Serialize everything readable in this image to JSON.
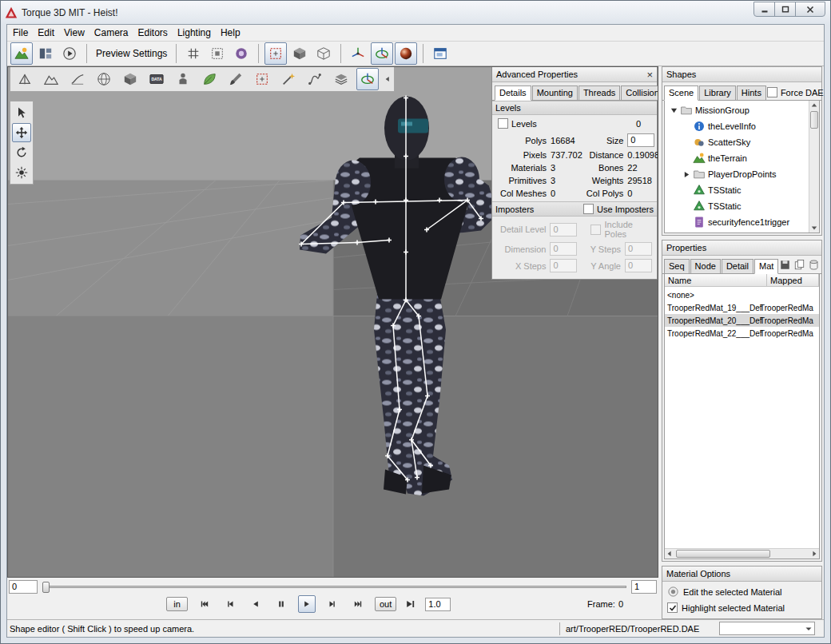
{
  "window": {
    "title": "Torque 3D MIT - Heist!"
  },
  "menu": [
    "File",
    "Edit",
    "View",
    "Camera",
    "Editors",
    "Lighting",
    "Help"
  ],
  "main_toolbar": {
    "preview_settings": "Preview Settings",
    "buttons": [
      {
        "selected": true
      },
      {
        "selected": false
      },
      {
        "selected": false
      },
      {
        "selected": false
      },
      {
        "selected": false
      },
      {
        "selected": false
      },
      {
        "selected": true
      },
      {
        "selected": false
      },
      {
        "selected": false
      },
      {
        "selected": false
      },
      {
        "selected": true
      },
      {
        "selected": true
      },
      {
        "selected": false
      }
    ]
  },
  "object_toolbar": {
    "buttons": [
      {
        "selected": false,
        "label": ""
      },
      {
        "selected": false,
        "label": ""
      },
      {
        "selected": false,
        "label": ""
      },
      {
        "selected": false,
        "label": ""
      },
      {
        "selected": false,
        "label": ""
      },
      {
        "selected": false,
        "label": "DATA"
      },
      {
        "selected": false,
        "label": ""
      },
      {
        "selected": false,
        "label": ""
      },
      {
        "selected": false,
        "label": ""
      },
      {
        "selected": false,
        "label": ""
      },
      {
        "selected": false,
        "label": ""
      },
      {
        "selected": false,
        "label": ""
      },
      {
        "selected": false,
        "label": ""
      },
      {
        "selected": true,
        "label": ""
      }
    ]
  },
  "tool_palette": {
    "buttons": [
      {
        "selected": false
      },
      {
        "selected": true
      },
      {
        "selected": false
      },
      {
        "selected": false
      }
    ]
  },
  "advanced_properties": {
    "title": "Advanced Properties",
    "close": "×",
    "tabs": [
      {
        "label": "Details",
        "selected": true
      },
      {
        "label": "Mounting",
        "selected": false
      },
      {
        "label": "Threads",
        "selected": false
      },
      {
        "label": "Collision",
        "selected": false
      }
    ],
    "levels": {
      "header": "Levels",
      "label": "Levels",
      "checked": false,
      "count": "0"
    },
    "stats": [
      {
        "label": "Polys",
        "value": "16684",
        "kind": "text"
      },
      {
        "label": "Size",
        "value": "0",
        "kind": "field"
      },
      {
        "label": "Pixels",
        "value": "737.702",
        "kind": "text"
      },
      {
        "label": "Distance",
        "value": "0.19098",
        "kind": "text"
      },
      {
        "label": "Materials",
        "value": "3",
        "kind": "text"
      },
      {
        "label": "Bones",
        "value": "22",
        "kind": "text"
      },
      {
        "label": "Primitives",
        "value": "3",
        "kind": "text"
      },
      {
        "label": "Weights",
        "value": "29518",
        "kind": "text"
      },
      {
        "label": "Col Meshes",
        "value": "0",
        "kind": "text"
      },
      {
        "label": "Col Polys",
        "value": "0",
        "kind": "text"
      }
    ],
    "imposters": {
      "header": "Imposters",
      "label": "Use Imposters",
      "checked": false,
      "fields": [
        {
          "label": "Detail Level",
          "value": "0",
          "kind": "field",
          "checked": false,
          "disabled": true
        },
        {
          "label": "Include Poles",
          "value": "",
          "kind": "checkbox",
          "checked": false,
          "disabled": true
        },
        {
          "label": "Dimension",
          "value": "0",
          "kind": "field",
          "checked": false,
          "disabled": true
        },
        {
          "label": "Y Steps",
          "value": "0",
          "kind": "field",
          "checked": false,
          "disabled": true
        },
        {
          "label": "X Steps",
          "value": "0",
          "kind": "field",
          "checked": false,
          "disabled": true
        },
        {
          "label": "Y Angle",
          "value": "0",
          "kind": "field",
          "checked": false,
          "disabled": true
        }
      ]
    }
  },
  "shapes": {
    "title": "Shapes",
    "tabs": [
      {
        "label": "Scene",
        "selected": true
      },
      {
        "label": "Library",
        "selected": false
      },
      {
        "label": "Hints",
        "selected": false
      }
    ],
    "force_dae": {
      "label": "Force DAE",
      "checked": false
    },
    "tree": [
      {
        "label": "MissionGroup",
        "depth": 0,
        "kind": "folder",
        "expandable": true,
        "expanded": true
      },
      {
        "label": "theLevelInfo",
        "depth": 1,
        "kind": "info",
        "expandable": false,
        "expanded": false
      },
      {
        "label": "ScatterSky",
        "depth": 1,
        "kind": "sky",
        "expandable": false,
        "expanded": false
      },
      {
        "label": "theTerrain",
        "depth": 1,
        "kind": "terrain",
        "expandable": false,
        "expanded": false
      },
      {
        "label": "PlayerDropPoints",
        "depth": 1,
        "kind": "folder",
        "expandable": true,
        "expanded": false
      },
      {
        "label": "TSStatic",
        "depth": 1,
        "kind": "static",
        "expandable": false,
        "expanded": false
      },
      {
        "label": "TSStatic",
        "depth": 1,
        "kind": "static",
        "expandable": false,
        "expanded": false
      },
      {
        "label": "securityfence1trigger",
        "depth": 1,
        "kind": "trigger",
        "expandable": false,
        "expanded": false
      }
    ]
  },
  "properties": {
    "title": "Properties",
    "tabs": [
      {
        "label": "Seq",
        "selected": false
      },
      {
        "label": "Node",
        "selected": false
      },
      {
        "label": "Detail",
        "selected": false
      },
      {
        "label": "Mat",
        "selected": true
      }
    ],
    "columns": [
      "Name",
      "Mapped"
    ],
    "rows": [
      {
        "name": "<none>",
        "mapped": "",
        "selected": false
      },
      {
        "name": "TrooperRedMat_19___Def",
        "mapped": "TrooperRedMa",
        "selected": false
      },
      {
        "name": "TrooperRedMat_20___Def",
        "mapped": "TrooperRedMa",
        "selected": true
      },
      {
        "name": "TrooperRedMat_22___Def",
        "mapped": "TrooperRedMa",
        "selected": false
      }
    ]
  },
  "material_options": {
    "title": "Material Options",
    "items": [
      {
        "kind": "button",
        "label": "Edit the selected Material",
        "checked": false
      },
      {
        "kind": "checkbox",
        "label": "Highlight selected Material",
        "checked": true
      }
    ]
  },
  "timeline": {
    "start": "0",
    "end": "1",
    "level": 0,
    "in": "in",
    "out": "out",
    "transport": [
      {
        "selected": false
      },
      {
        "selected": false
      },
      {
        "selected": false
      },
      {
        "selected": false
      },
      {
        "selected": true
      },
      {
        "selected": false
      },
      {
        "selected": false
      }
    ],
    "speed": "1.0",
    "frame_label": "Frame:",
    "frame": "0"
  },
  "status_bar": {
    "message": "Shape editor ( Shift Click ) to speed up camera.",
    "file": "art/TrooperRED/TrooperRED.DAE"
  }
}
